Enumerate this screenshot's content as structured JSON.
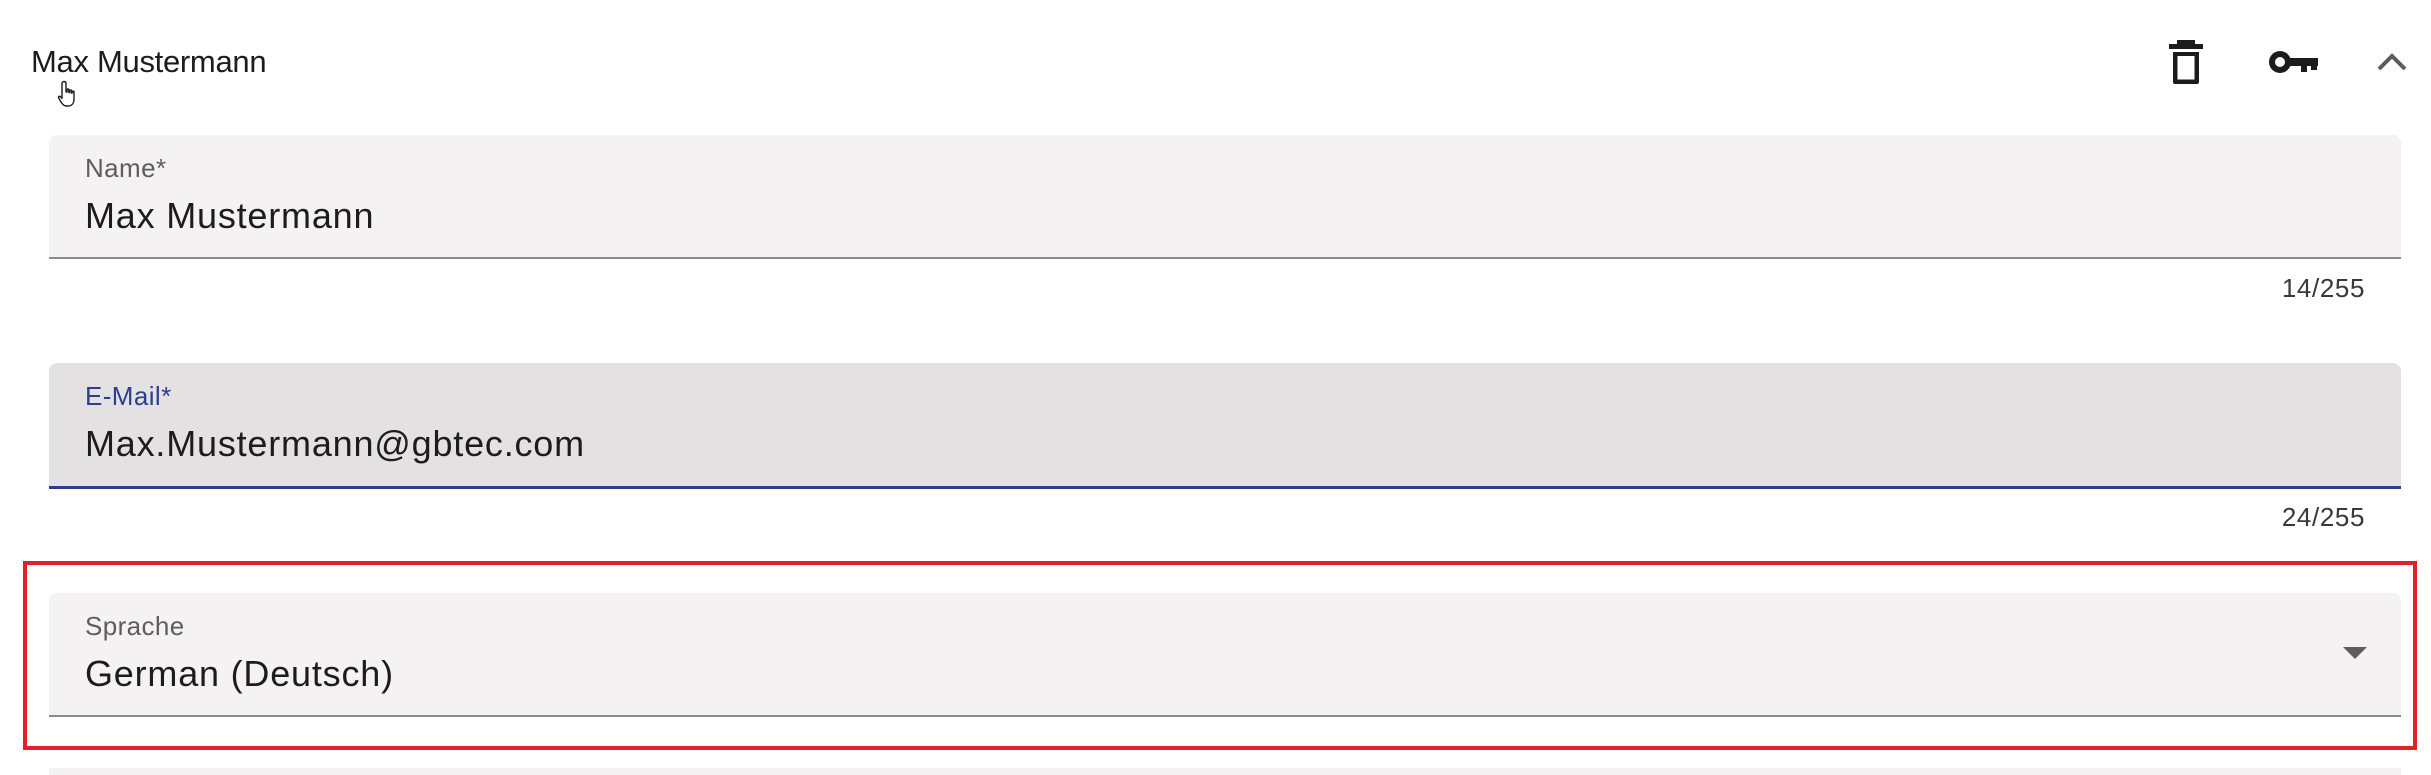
{
  "header": {
    "title": "Max Mustermann",
    "icons": {
      "delete": "trash-icon",
      "key": "key-icon",
      "collapse": "chevron-up-icon",
      "cursor": "hand-pointer-cursor"
    }
  },
  "form": {
    "name": {
      "label": "Name*",
      "value": "Max Mustermann",
      "counter": "14/255"
    },
    "email": {
      "label": "E-Mail*",
      "value": "Max.Mustermann@gbtec.com",
      "counter": "24/255"
    },
    "language": {
      "label": "Sprache",
      "value": "German (Deutsch)"
    }
  },
  "colors": {
    "focus_accent": "#2c3e8f",
    "highlight_border": "#e3202a",
    "field_background": "#f5f2f3"
  }
}
